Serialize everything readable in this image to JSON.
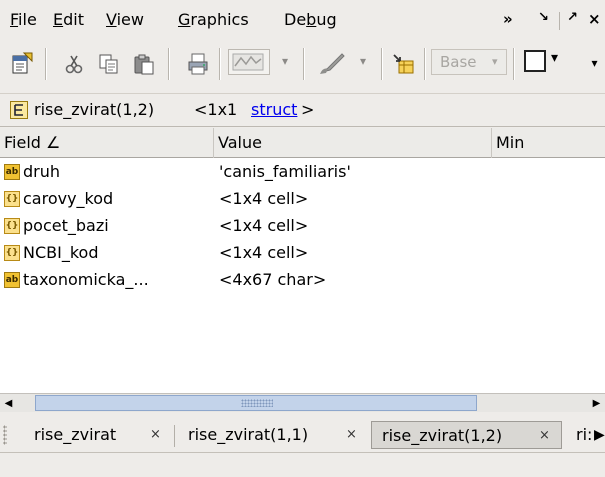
{
  "menubar": {
    "items": [
      {
        "label": "File",
        "mnemonic": "F",
        "rest": "ile"
      },
      {
        "label": "Edit",
        "mnemonic": "E",
        "rest": "dit"
      },
      {
        "label": "View",
        "mnemonic": "V",
        "rest": "iew"
      },
      {
        "label": "Graphics",
        "mnemonic": "G",
        "rest": "raphics"
      },
      {
        "label": "Debug",
        "pre": "De",
        "mnemonic": "b",
        "rest": "ug"
      }
    ],
    "overflow": "»",
    "undock": "↘",
    "dock": "↗",
    "close": "×"
  },
  "toolbar": {
    "base_label": "Base",
    "icons": [
      "new-variable-icon",
      "cut-icon",
      "copy-icon",
      "paste-icon",
      "print-icon",
      "plot-icon",
      "brush-icon",
      "insert-field-icon",
      "checkbox-icon"
    ]
  },
  "path": {
    "var_name": "rise_zvirat(1,2)",
    "size": "<1x1 ",
    "type_link": "struct",
    "close": ">"
  },
  "table": {
    "columns": [
      "Field ∠",
      "Value",
      "Min"
    ],
    "rows": [
      {
        "icon": "ab",
        "field": "druh",
        "value": "'canis_familiaris'"
      },
      {
        "icon": "cell",
        "field": "carovy_kod",
        "value": "<1x4 cell>"
      },
      {
        "icon": "cell",
        "field": "pocet_bazi",
        "value": "<1x4 cell>"
      },
      {
        "icon": "cell",
        "field": "NCBI_kod",
        "value": "<1x4 cell>"
      },
      {
        "icon": "ab",
        "field": "taxonomicka_...",
        "value": "<4x67 char>"
      }
    ]
  },
  "tabs": [
    {
      "label": "rise_zvirat",
      "close": "×",
      "selected": false
    },
    {
      "label": "rise_zvirat(1,1)",
      "close": "×",
      "selected": false
    },
    {
      "label": "rise_zvirat(1,2)",
      "close": "×",
      "selected": true
    },
    {
      "label": "ri:",
      "close": "",
      "selected": false
    }
  ],
  "colors": {
    "selected_tab": "#d9d7d3",
    "scroll_thumb": "#c3d3ea",
    "link": "#0000ee"
  }
}
